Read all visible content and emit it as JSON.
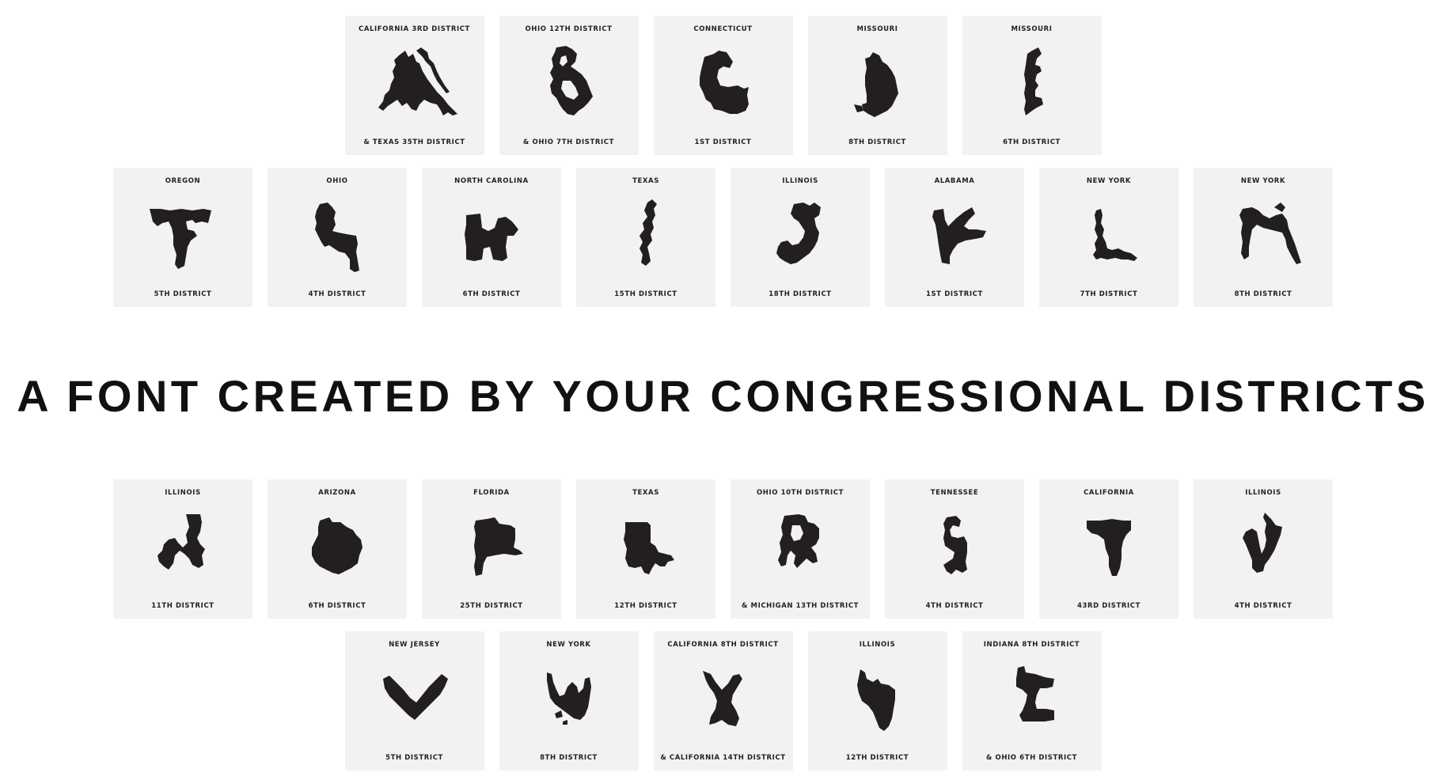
{
  "headline": "A FONT CREATED BY YOUR CONGRESSIONAL DISTRICTS",
  "colors": {
    "background": "#ffffff",
    "tile": "#f2f2f2",
    "shape": "#231f20",
    "headline": "#111111"
  },
  "rows": [
    {
      "tiles": [
        {
          "letter": "A",
          "state": "CALIFORNIA 3RD DISTRICT",
          "district": "& TEXAS 35TH DISTRICT"
        },
        {
          "letter": "B",
          "state": "OHIO 12TH DISTRICT",
          "district": "& OHIO 7TH DISTRICT"
        },
        {
          "letter": "C",
          "state": "CONNECTICUT",
          "district": "1ST DISTRICT"
        },
        {
          "letter": "D",
          "state": "MISSOURI",
          "district": "8TH DISTRICT"
        },
        {
          "letter": "E",
          "state": "MISSOURI",
          "district": "6TH DISTRICT"
        }
      ]
    },
    {
      "tiles": [
        {
          "letter": "F",
          "state": "OREGON",
          "district": "5TH DISTRICT"
        },
        {
          "letter": "G",
          "state": "OHIO",
          "district": "4TH DISTRICT"
        },
        {
          "letter": "H",
          "state": "NORTH CAROLINA",
          "district": "6TH DISTRICT"
        },
        {
          "letter": "I",
          "state": "TEXAS",
          "district": "15TH DISTRICT"
        },
        {
          "letter": "J",
          "state": "ILLINOIS",
          "district": "18TH DISTRICT"
        },
        {
          "letter": "K",
          "state": "ALABAMA",
          "district": "1ST DISTRICT"
        },
        {
          "letter": "L",
          "state": "NEW YORK",
          "district": "7TH DISTRICT"
        },
        {
          "letter": "M",
          "state": "NEW YORK",
          "district": "8TH DISTRICT"
        }
      ]
    },
    {
      "tiles": [
        {
          "letter": "N",
          "state": "ILLINOIS",
          "district": "11TH DISTRICT"
        },
        {
          "letter": "O",
          "state": "ARIZONA",
          "district": "6TH DISTRICT"
        },
        {
          "letter": "P",
          "state": "FLORIDA",
          "district": "25TH DISTRICT"
        },
        {
          "letter": "Q",
          "state": "TEXAS",
          "district": "12TH DISTRICT"
        },
        {
          "letter": "R",
          "state": "OHIO 10TH DISTRICT",
          "district": "& MICHIGAN 13TH DISTRICT"
        },
        {
          "letter": "S",
          "state": "TENNESSEE",
          "district": "4TH DISTRICT"
        },
        {
          "letter": "T",
          "state": "CALIFORNIA",
          "district": "43RD DISTRICT"
        },
        {
          "letter": "U",
          "state": "ILLINOIS",
          "district": "4TH DISTRICT"
        }
      ]
    },
    {
      "tiles": [
        {
          "letter": "V",
          "state": "NEW JERSEY",
          "district": "5TH DISTRICT"
        },
        {
          "letter": "W",
          "state": "NEW YORK",
          "district": "8TH DISTRICT"
        },
        {
          "letter": "X",
          "state": "CALIFORNIA 8TH DISTRICT",
          "district": "& CALIFORNIA 14TH DISTRICT"
        },
        {
          "letter": "Y",
          "state": "ILLINOIS",
          "district": "12TH DISTRICT"
        },
        {
          "letter": "Z",
          "state": "INDIANA 8TH DISTRICT",
          "district": "& OHIO 6TH DISTRICT"
        }
      ]
    }
  ]
}
